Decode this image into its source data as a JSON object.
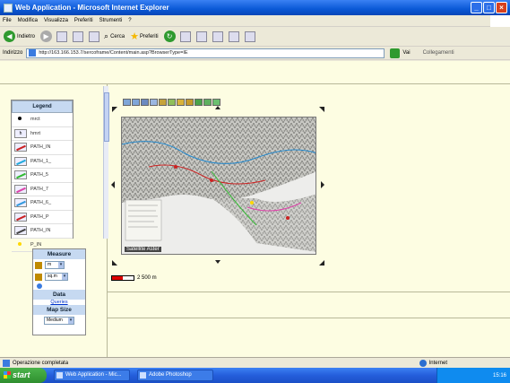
{
  "window": {
    "title": "Web Application - Microsoft Internet Explorer",
    "minimize": "_",
    "maximize": "□",
    "close": "×"
  },
  "menu": [
    "File",
    "Modifica",
    "Visualizza",
    "Preferiti",
    "Strumenti",
    "?"
  ],
  "toolbar": {
    "back_label": "Indietro",
    "search_label": "Cerca",
    "favorites_label": "Preferiti"
  },
  "address": {
    "label": "Indirizzo",
    "url": "http://163.166.153.7/sercoframe/Content/main.asp?BrowserType=IE",
    "go_label": "Vai",
    "links_label": "Collegamenti"
  },
  "legend": {
    "title": "Legend",
    "items": [
      {
        "label": "mrct",
        "icon": "dot-icon",
        "color": "#000000"
      },
      {
        "label": "hmrt",
        "icon": "h-box-icon",
        "color": "#000000"
      },
      {
        "label": "PATH_IN",
        "icon": "line-icon",
        "color": "#cc2222"
      },
      {
        "label": "PATH_1_",
        "icon": "line-icon",
        "color": "#22aadd"
      },
      {
        "label": "PATH_5",
        "icon": "line-icon",
        "color": "#33bb33"
      },
      {
        "label": "PATH_7",
        "icon": "line-icon",
        "color": "#dd44aa"
      },
      {
        "label": "PATH_6_",
        "icon": "line-icon",
        "color": "#3399dd"
      },
      {
        "label": "PATH_P",
        "icon": "line-icon",
        "color": "#cc2222"
      },
      {
        "label": "PATH_IN",
        "icon": "line-icon",
        "color": "#444444"
      },
      {
        "label": "P_IN",
        "icon": "yellow-dot-icon",
        "color": "#ffd800"
      }
    ]
  },
  "measure": {
    "title": "Measure",
    "length_unit": "m",
    "area_unit": "sq.m",
    "data_title": "Data",
    "queries_label": "Queries",
    "mapsize_title": "Map Size",
    "mapsize_value": "Medium"
  },
  "map": {
    "credit": "Satellite Aster",
    "scale_label": "2 500 m"
  },
  "status": {
    "left": "Operazione completata",
    "zone": "Internet"
  },
  "taskbar": {
    "start": "start",
    "items": [
      "Web Application - Mic...",
      "Adobe Photoshop"
    ],
    "clock": "15:16"
  },
  "colors": {
    "page_bg": "#fdfde2",
    "legend_header": "#c6d9f1",
    "taskbar": "#245edb"
  }
}
